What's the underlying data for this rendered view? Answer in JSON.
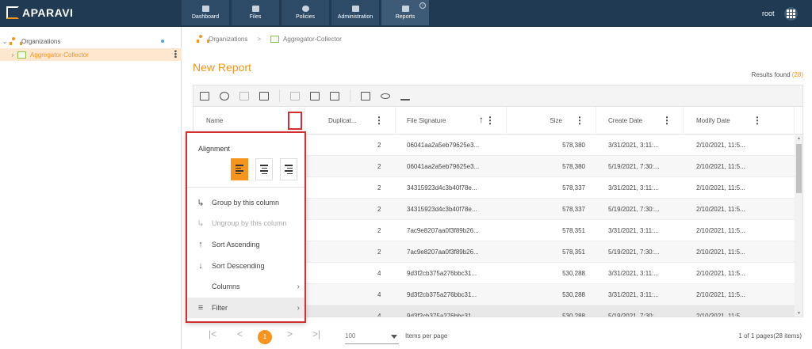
{
  "app": {
    "logo_text": "APARAVI",
    "user": "root"
  },
  "nav": [
    {
      "label": "Dashboard",
      "icon": "dashboard-icon"
    },
    {
      "label": "Files",
      "icon": "folder-icon"
    },
    {
      "label": "Policies",
      "icon": "gear-icon"
    },
    {
      "label": "Administration",
      "icon": "users-icon"
    },
    {
      "label": "Reports",
      "icon": "report-icon",
      "active": true
    }
  ],
  "sidebar": {
    "items": [
      {
        "label": "Organizations",
        "chevron": "⌄"
      },
      {
        "label": "Aggregator-Collector",
        "chevron": "›"
      }
    ]
  },
  "breadcrumb": {
    "items": [
      "Organizations",
      "Aggregator-Collector"
    ],
    "separator": ">"
  },
  "page": {
    "title": "New Report",
    "results_label": "Results found",
    "results_count": "(28)"
  },
  "table": {
    "columns": [
      "Name",
      "Duplicat...",
      "File Signature",
      "Size",
      "Create Date",
      "Modify Date"
    ],
    "rows": [
      [
        "",
        "2",
        "06041aa2a5eb79625e3...",
        "578,380",
        "3/31/2021, 3:11:...",
        "2/10/2021, 11:5..."
      ],
      [
        "",
        "2",
        "06041aa2a5eb79625e3...",
        "578,380",
        "5/19/2021, 7:30:...",
        "2/10/2021, 11:5..."
      ],
      [
        "",
        "2",
        "34315923d4c3b40f78e...",
        "578,337",
        "3/31/2021, 3:11:...",
        "2/10/2021, 11:5..."
      ],
      [
        "",
        "2",
        "34315923d4c3b40f78e...",
        "578,337",
        "5/19/2021, 7:30:...",
        "2/10/2021, 11:5..."
      ],
      [
        "",
        "2",
        "7ac9e8207aa0f3f89b26...",
        "578,351",
        "3/31/2021, 3:11:...",
        "2/10/2021, 11:5..."
      ],
      [
        "",
        "2",
        "7ac9e8207aa0f3f89b26...",
        "578,351",
        "5/19/2021, 7:30:...",
        "2/10/2021, 11:5..."
      ],
      [
        "",
        "4",
        "9d3f2cb375a276bbc31...",
        "530,288",
        "3/31/2021, 3:11:...",
        "2/10/2021, 11:5..."
      ],
      [
        "",
        "4",
        "9d3f2cb375a276bbc31...",
        "530,288",
        "3/31/2021, 3:11:...",
        "2/10/2021, 11:5..."
      ],
      [
        "",
        "4",
        "9d3f2cb375a276bbc31...",
        "530,288",
        "5/19/2021, 7:30:...",
        "2/10/2021, 11:5..."
      ]
    ]
  },
  "pager": {
    "first": "|<",
    "prev": "<",
    "page": "1",
    "next": ">",
    "last": ">|",
    "page_size": "100",
    "items_label": "Items per page",
    "info": "1 of 1 pages(28 items)"
  },
  "column_menu": {
    "alignment_label": "Alignment",
    "items": [
      {
        "label": "Group by this column",
        "icon": "group-icon",
        "disabled": false
      },
      {
        "label": "Ungroup by this column",
        "icon": "ungroup-icon",
        "disabled": true
      },
      {
        "label": "Sort Ascending",
        "icon": "arrow-up-icon",
        "disabled": false
      },
      {
        "label": "Sort Descending",
        "icon": "arrow-down-icon",
        "disabled": false
      },
      {
        "label": "Columns",
        "icon": "",
        "disabled": false,
        "submenu": true
      },
      {
        "label": "Filter",
        "icon": "filter-icon",
        "disabled": false,
        "submenu": true
      }
    ]
  },
  "colors": {
    "accent": "#f7941d",
    "topbar": "#1f3a52",
    "highlight": "#d32f2f"
  }
}
